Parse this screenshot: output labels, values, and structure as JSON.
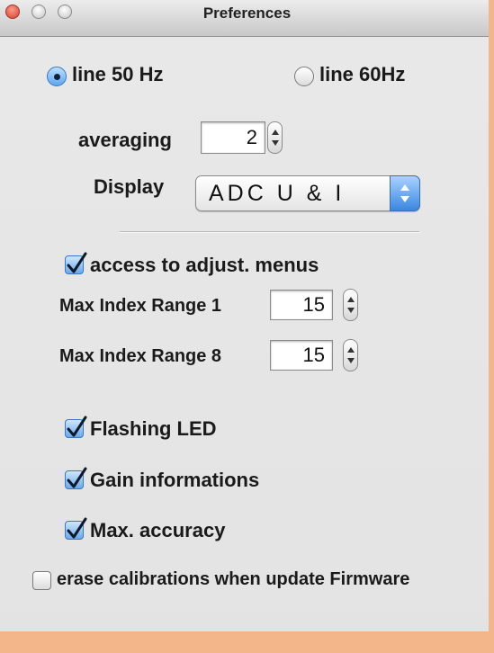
{
  "window": {
    "title": "Preferences"
  },
  "line_frequency": {
    "option_50": {
      "label": "line 50 Hz",
      "selected": true
    },
    "option_60": {
      "label": "line 60Hz",
      "selected": false
    }
  },
  "averaging": {
    "label": "averaging",
    "value": "2"
  },
  "display": {
    "label": "Display",
    "value": "ADC U & I"
  },
  "adjust_menus": {
    "label": "access to adjust. menus",
    "checked": true
  },
  "index_range_1": {
    "label": "Max Index Range 1",
    "value": "15"
  },
  "index_range_8": {
    "label": "Max Index Range 8",
    "value": "15"
  },
  "options": {
    "flashing_led": {
      "label": "Flashing LED",
      "checked": true
    },
    "gain_info": {
      "label": "Gain informations",
      "checked": true
    },
    "max_accuracy": {
      "label": "Max. accuracy",
      "checked": true
    },
    "erase_calibrations": {
      "label": "erase calibrations when update Firmware",
      "checked": false
    }
  },
  "colors": {
    "accent_blue": "#3b86e0",
    "window_background": "#e6e6e6",
    "frame_outer": "#f2b68a"
  }
}
